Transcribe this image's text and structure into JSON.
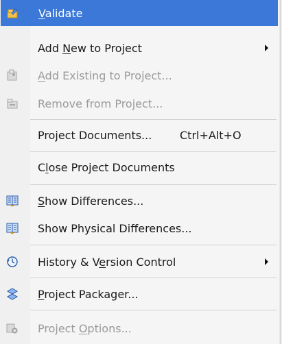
{
  "menu": {
    "items": [
      {
        "pre": "",
        "mn": "V",
        "post": "alidate",
        "shortcut": "",
        "icon": "validate-icon"
      },
      {
        "pre": "Add ",
        "mn": "N",
        "post": "ew to Project",
        "shortcut": "",
        "icon": ""
      },
      {
        "pre": "",
        "mn": "A",
        "post": "dd Existing to Project...",
        "shortcut": "",
        "icon": "add-existing-icon"
      },
      {
        "pre": "Remove from Project...",
        "mn": "",
        "post": "",
        "shortcut": "",
        "icon": "remove-icon"
      },
      {
        "pre": "Project Documents...",
        "mn": "",
        "post": "",
        "shortcut": "Ctrl+Alt+O",
        "icon": ""
      },
      {
        "pre": "C",
        "mn": "l",
        "post": "ose Project Documents",
        "shortcut": "",
        "icon": ""
      },
      {
        "pre": "",
        "mn": "S",
        "post": "how Differences...",
        "shortcut": "",
        "icon": "show-differences-icon"
      },
      {
        "pre": "Show Physical Differences...",
        "mn": "",
        "post": "",
        "shortcut": "",
        "icon": "show-physical-differences-icon"
      },
      {
        "pre": "History & V",
        "mn": "e",
        "post": "rsion Control",
        "shortcut": "",
        "icon": "history-icon"
      },
      {
        "pre": "",
        "mn": "P",
        "post": "roject Packager...",
        "shortcut": "",
        "icon": "packager-icon"
      },
      {
        "pre": "Project ",
        "mn": "O",
        "post": "ptions...",
        "shortcut": "",
        "icon": "options-icon"
      }
    ]
  }
}
